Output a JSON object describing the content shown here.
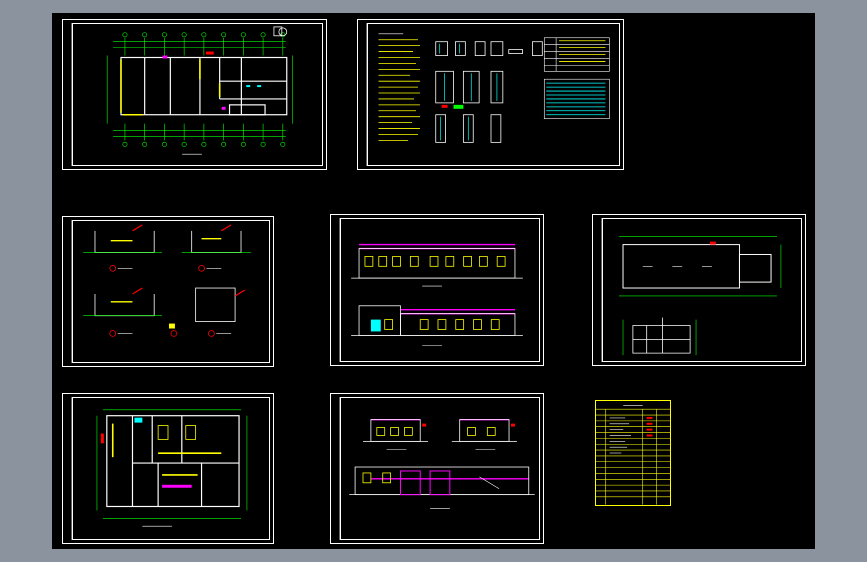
{
  "sheets": [
    {
      "id": "floor-plan-1",
      "kind": "floor-plan"
    },
    {
      "id": "design-notes-door-window",
      "kind": "notes-schedule"
    },
    {
      "id": "detail-sections",
      "kind": "details"
    },
    {
      "id": "front-back-elevations",
      "kind": "elevations"
    },
    {
      "id": "roof-plan-section",
      "kind": "roof-plan"
    },
    {
      "id": "floor-plan-2",
      "kind": "floor-plan"
    },
    {
      "id": "side-elevations",
      "kind": "elevations"
    },
    {
      "id": "drawing-list",
      "kind": "drawing-index"
    }
  ],
  "colors": {
    "background": "#8a939e",
    "modelspace": "#000000",
    "frame": "#ffffff",
    "wall": "#ffffff",
    "dimension": "#00ff00",
    "highlight": "#ffff00",
    "accent": "#ff00ff",
    "hatch": "#00ffff",
    "red": "#ff0000"
  }
}
